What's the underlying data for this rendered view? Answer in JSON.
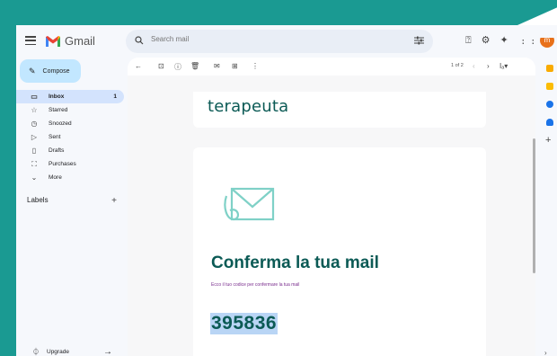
{
  "app": {
    "name": "Gmail"
  },
  "search": {
    "placeholder": "Search mail"
  },
  "avatar": {
    "letter": "m",
    "color": "#e8711a"
  },
  "sidebar": {
    "compose_label": "Compose",
    "items": [
      {
        "label": "Inbox",
        "icon": "inbox-icon",
        "count": "1",
        "active": true
      },
      {
        "label": "Starred",
        "icon": "star-icon"
      },
      {
        "label": "Snoozed",
        "icon": "clock-icon"
      },
      {
        "label": "Sent",
        "icon": "send-icon"
      },
      {
        "label": "Drafts",
        "icon": "draft-icon"
      },
      {
        "label": "Purchases",
        "icon": "bag-icon"
      },
      {
        "label": "More",
        "icon": "chevron-down-icon"
      }
    ],
    "labels_title": "Labels",
    "upgrade_label": "Upgrade"
  },
  "toolbar": {
    "pager": "1 of 2"
  },
  "email": {
    "brand": "terapeuta",
    "heading": "Conferma la tua mail",
    "subtext": "Ecco il tuo codice per confermare la tua mail",
    "code": "395836",
    "accent": "#0b5a55",
    "sub_color": "#7a2e8e"
  },
  "colors": {
    "frame": "#1a9a92",
    "compose": "#c2e7ff",
    "active_nav": "#d3e3fd"
  }
}
